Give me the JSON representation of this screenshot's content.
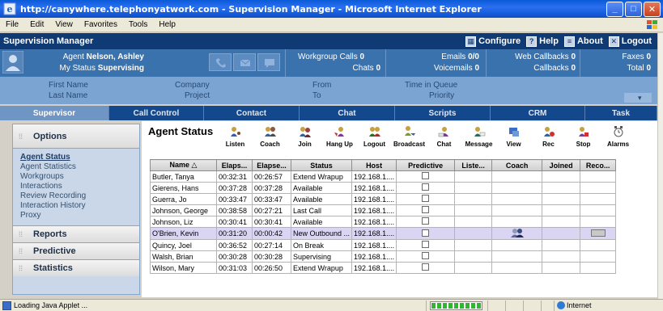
{
  "window": {
    "title": "http://canywhere.telephonyatwork.com - Supervision Manager - Microsoft Internet Explorer",
    "minimize": "_",
    "maximize": "□",
    "close": "✕"
  },
  "menu": [
    "File",
    "Edit",
    "View",
    "Favorites",
    "Tools",
    "Help"
  ],
  "app": {
    "title": "Supervision Manager",
    "configure": "Configure",
    "help": "Help",
    "about": "About",
    "logout": "Logout"
  },
  "agent": {
    "agent_label": "Agent",
    "agent_name": "Nelson, Ashley",
    "status_label": "My Status",
    "status_value": "Supervising"
  },
  "stats": {
    "workgroup_calls_label": "Workgroup Calls",
    "workgroup_calls": "0",
    "chats_label": "Chats",
    "chats": "0",
    "emails_label": "Emails",
    "emails": "0/0",
    "voicemails_label": "Voicemails",
    "voicemails": "0",
    "web_callbacks_label": "Web Callbacks",
    "web_callbacks": "0",
    "callbacks_label": "Callbacks",
    "callbacks": "0",
    "faxes_label": "Faxes",
    "faxes": "0",
    "total_label": "Total",
    "total": "0"
  },
  "fields": {
    "first_name": "First Name",
    "last_name": "Last Name",
    "company": "Company",
    "project": "Project",
    "from": "From",
    "to": "To",
    "time_in_queue": "Time in Queue",
    "priority": "Priority"
  },
  "nav_tabs": [
    "Supervisor",
    "Call Control",
    "Contact",
    "Chat",
    "Scripts",
    "CRM",
    "Task"
  ],
  "sidebar": {
    "options_label": "Options",
    "items": [
      "Agent Status",
      "Agent Statistics",
      "Workgroups",
      "Interactions",
      "Review Recording",
      "Interaction History",
      "Proxy"
    ],
    "reports_label": "Reports",
    "predictive_label": "Predictive",
    "statistics_label": "Statistics"
  },
  "main": {
    "heading": "Agent Status",
    "tools": [
      "Listen",
      "Coach",
      "Join",
      "Hang Up",
      "Logout",
      "Broadcast",
      "Chat",
      "Message",
      "View",
      "Rec",
      "Stop",
      "Alarms"
    ],
    "columns": [
      "Name △",
      "Elaps...",
      "Elapse...",
      "Status",
      "Host",
      "Predictive",
      "Liste...",
      "Coach",
      "Joined",
      "Reco..."
    ],
    "rows": [
      {
        "name": "Butler, Tanya",
        "e1": "00:32:31",
        "e2": "00:26:57",
        "status": "Extend Wrapup",
        "host": "192.168.1...."
      },
      {
        "name": "Gierens, Hans",
        "e1": "00:37:28",
        "e2": "00:37:28",
        "status": "Available",
        "host": "192.168.1...."
      },
      {
        "name": "Guerra, Jo",
        "e1": "00:33:47",
        "e2": "00:33:47",
        "status": "Available",
        "host": "192.168.1...."
      },
      {
        "name": "Johnson, George",
        "e1": "00:38:58",
        "e2": "00:27:21",
        "status": "Last Call",
        "host": "192.168.1...."
      },
      {
        "name": "Johnson, Liz",
        "e1": "00:30:41",
        "e2": "00:30:41",
        "status": "Available",
        "host": "192.168.1...."
      },
      {
        "name": "O'Brien, Kevin",
        "e1": "00:31:20",
        "e2": "00:00:42",
        "status": "New Outbound ...",
        "host": "192.168.1...."
      },
      {
        "name": "Quincy, Joel",
        "e1": "00:36:52",
        "e2": "00:27:14",
        "status": "On Break",
        "host": "192.168.1...."
      },
      {
        "name": "Walsh, Brian",
        "e1": "00:30:28",
        "e2": "00:30:28",
        "status": "Supervising",
        "host": "192.168.1...."
      },
      {
        "name": "Wilson, Mary",
        "e1": "00:31:03",
        "e2": "00:26:50",
        "status": "Extend Wrapup",
        "host": "192.168.1...."
      }
    ]
  },
  "statusbar": {
    "text": "Loading Java Applet ...",
    "zone": "Internet"
  }
}
